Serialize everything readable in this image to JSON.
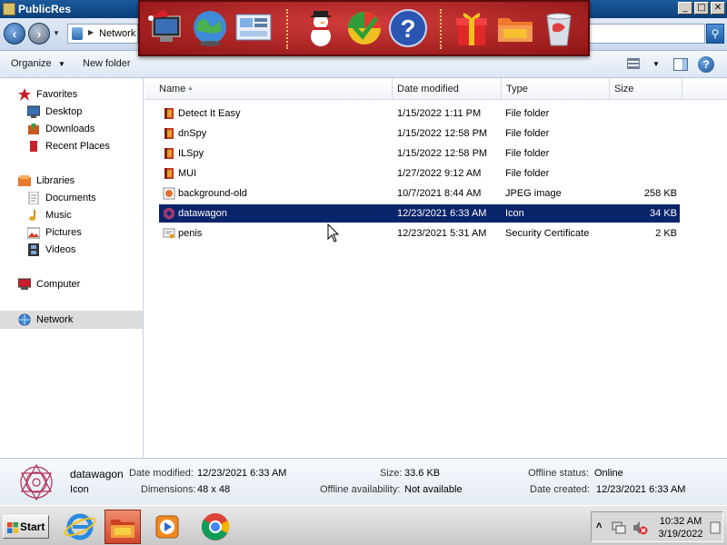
{
  "window": {
    "title": "PublicRes"
  },
  "title_buttons": {
    "minimize": "_",
    "maximize": "□",
    "close": "✕"
  },
  "address": {
    "path_label": "Network"
  },
  "toolbar": {
    "organize": "Organize",
    "new_folder": "New folder"
  },
  "nav": {
    "favorites": "Favorites",
    "desktop": "Desktop",
    "downloads": "Downloads",
    "recent_places": "Recent Places",
    "libraries": "Libraries",
    "documents": "Documents",
    "music": "Music",
    "pictures": "Pictures",
    "videos": "Videos",
    "computer": "Computer",
    "network": "Network"
  },
  "columns": {
    "name": "Name",
    "date": "Date modified",
    "type": "Type",
    "size": "Size"
  },
  "files": [
    {
      "name": "Detect It Easy",
      "date": "1/15/2022 1:11 PM",
      "type": "File folder",
      "size": "",
      "icon": "folder-icon"
    },
    {
      "name": "dnSpy",
      "date": "1/15/2022 12:58 PM",
      "type": "File folder",
      "size": "",
      "icon": "folder-icon"
    },
    {
      "name": "ILSpy",
      "date": "1/15/2022 12:58 PM",
      "type": "File folder",
      "size": "",
      "icon": "folder-icon"
    },
    {
      "name": "MUI",
      "date": "1/27/2022 9:12 AM",
      "type": "File folder",
      "size": "",
      "icon": "folder-icon"
    },
    {
      "name": "background-old",
      "date": "10/7/2021 8:44 AM",
      "type": "JPEG image",
      "size": "258 KB",
      "icon": "image-file-icon"
    },
    {
      "name": "datawagon",
      "date": "12/23/2021 6:33 AM",
      "type": "Icon",
      "size": "34 KB",
      "icon": "icon-file-icon",
      "selected": true
    },
    {
      "name": "penis",
      "date": "12/23/2021 5:31 AM",
      "type": "Security Certificate",
      "size": "2 KB",
      "icon": "certificate-icon"
    }
  ],
  "details": {
    "name": "datawagon",
    "type": "Icon",
    "date_modified_label": "Date modified:",
    "date_modified": "12/23/2021 6:33 AM",
    "dimensions_label": "Dimensions:",
    "dimensions": "48 x 48",
    "size_label": "Size:",
    "size": "33.6 KB",
    "offline_availability_label": "Offline availability:",
    "offline_availability": "Not available",
    "offline_status_label": "Offline status:",
    "offline_status": "Online",
    "date_created_label": "Date created:",
    "date_created": "12/23/2021 6:33 AM"
  },
  "taskbar": {
    "start": "Start",
    "time": "10:32 AM",
    "date": "3/19/2022"
  },
  "colors": {
    "selection": "#0a246a",
    "dock": "#b82222",
    "titlebar": "#0b3f7a"
  }
}
